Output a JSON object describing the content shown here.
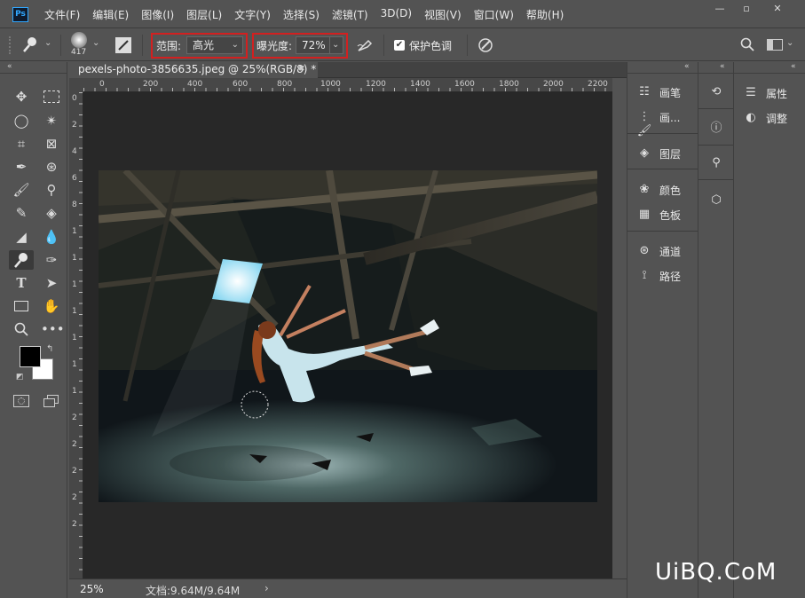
{
  "app": {
    "logo": "Ps"
  },
  "menu": [
    "文件(F)",
    "编辑(E)",
    "图像(I)",
    "图层(L)",
    "文字(Y)",
    "选择(S)",
    "滤镜(T)",
    "3D(D)",
    "视图(V)",
    "窗口(W)",
    "帮助(H)"
  ],
  "window_controls": {
    "minimize": "—",
    "maximize": "▫",
    "close": "✕"
  },
  "options": {
    "brush_size": "417",
    "range_label": "范围:",
    "range_value": "高光",
    "exposure_label": "曝光度:",
    "exposure_value": "72%",
    "protect_tones_label": "保护色调",
    "protect_tones_checked": true
  },
  "document": {
    "tab_title": "pexels-photo-3856635.jpeg @ 25%(RGB/8) *",
    "tab_close": "✖",
    "ruler_h": [
      "0",
      "200",
      "400",
      "600",
      "800",
      "1000",
      "1200",
      "1400",
      "1600",
      "1800",
      "2000",
      "2200"
    ],
    "ruler_v": [
      "0",
      "2",
      "4",
      "6",
      "8",
      "1",
      "1",
      "1",
      "1",
      "1",
      "1",
      "1",
      "2",
      "2",
      "2",
      "2",
      "2"
    ],
    "zoom": "25%",
    "doc_size": "文档:9.64M/9.64M",
    "status_arrow": "›"
  },
  "panels": {
    "col1": [
      {
        "icon": "brush-settings-icon",
        "label": "画笔"
      },
      {
        "icon": "brush-presets-icon",
        "label": "画..."
      },
      {
        "icon": "layers-icon",
        "label": "图层"
      },
      {
        "icon": "color-icon",
        "label": "颜色"
      },
      {
        "icon": "swatches-icon",
        "label": "色板"
      },
      {
        "icon": "channels-icon",
        "label": "通道"
      },
      {
        "icon": "paths-icon",
        "label": "路径"
      }
    ],
    "col3": [
      {
        "icon": "properties-icon",
        "label": "属性"
      },
      {
        "icon": "adjustments-icon",
        "label": "调整"
      }
    ]
  },
  "watermark": "UiBQ.CoM",
  "colors": {
    "accent_red": "#d22020",
    "ps_blue": "#31a8ff"
  }
}
